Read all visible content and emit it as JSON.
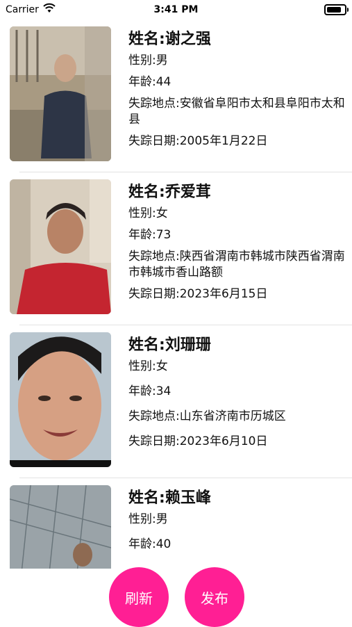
{
  "status_bar": {
    "carrier": "Carrier",
    "time": "3:41 PM"
  },
  "labels": {
    "name": "姓名:",
    "gender": "性别:",
    "age": "年龄:",
    "location": "失踪地点:",
    "date": "失踪日期:"
  },
  "people": [
    {
      "name": "谢之强",
      "gender": "男",
      "age": "44",
      "location": "安徽省阜阳市太和县阜阳市太和县",
      "date": "2005年1月22日"
    },
    {
      "name": "乔爱茸",
      "gender": "女",
      "age": "73",
      "location": "陕西省渭南市韩城市陕西省渭南市韩城市香山路额",
      "date": "2023年6月15日"
    },
    {
      "name": "刘珊珊",
      "gender": "女",
      "age": "34",
      "location": "山东省济南市历城区",
      "date": "2023年6月10日"
    },
    {
      "name": "赖玉峰",
      "gender": "男",
      "age": "40"
    }
  ],
  "buttons": {
    "refresh": "刷新",
    "publish": "发布"
  },
  "colors": {
    "accent": "#ff1f94"
  }
}
